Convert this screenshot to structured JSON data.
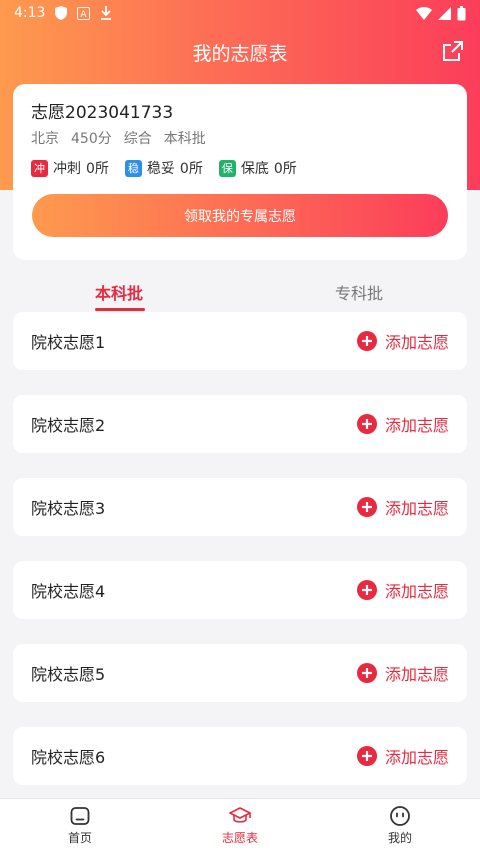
{
  "status_bar": {
    "time": "4:13",
    "indicators": [
      "shield-icon",
      "a-badge-icon",
      "download-icon",
      "wifi-icon",
      "signal-icon",
      "battery-icon"
    ]
  },
  "header": {
    "title": "我的志愿表",
    "share_icon": "share-icon"
  },
  "summary": {
    "wish_title": "志愿2023041733",
    "region": "北京",
    "score": "450分",
    "subject": "综合",
    "batch": "本科批",
    "risk": [
      {
        "badge": "冲",
        "label": "冲刺",
        "count": "0所",
        "color": "#e8293f"
      },
      {
        "badge": "稳",
        "label": "稳妥",
        "count": "0所",
        "color": "#2f8ee8"
      },
      {
        "badge": "保",
        "label": "保底",
        "count": "0所",
        "color": "#22b26b"
      }
    ],
    "claim_button": "领取我的专属志愿"
  },
  "tabs": {
    "undergraduate": "本科批",
    "junior_college": "专科批"
  },
  "slots": [
    {
      "label": "院校志愿1",
      "action": "添加志愿"
    },
    {
      "label": "院校志愿2",
      "action": "添加志愿"
    },
    {
      "label": "院校志愿3",
      "action": "添加志愿"
    },
    {
      "label": "院校志愿4",
      "action": "添加志愿"
    },
    {
      "label": "院校志愿5",
      "action": "添加志愿"
    },
    {
      "label": "院校志愿6",
      "action": "添加志愿"
    }
  ],
  "bottom_nav": {
    "home": "首页",
    "wish_table": "志愿表",
    "mine": "我的"
  },
  "colors": {
    "accent": "#e8293f",
    "gradient_start": "#fe9a4e",
    "gradient_end": "#fb3d5a"
  }
}
